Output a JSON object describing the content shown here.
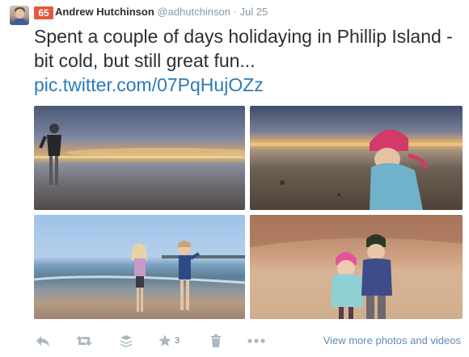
{
  "tweet": {
    "klout_score": "65",
    "author_name": "Andrew Hutchinson",
    "author_handle": "@adhutchinson",
    "separator": "·",
    "timestamp": "Jul 25",
    "text": "Spent a couple of days holidaying in Phillip Island - bit cold, but still great fun...",
    "link": "pic.twitter.com/07PqHujOZz"
  },
  "photos": [
    {
      "alt": "person standing on beach at sunset"
    },
    {
      "alt": "child in pink hat playing in sand"
    },
    {
      "alt": "two children on beach by the water"
    },
    {
      "alt": "two children in beanies on sand dunes"
    }
  ],
  "actions": {
    "favorite_count": "3",
    "view_more_label": "View more photos and videos"
  },
  "icons": [
    "reply-icon",
    "retweet-icon",
    "buffer-icon",
    "star-icon",
    "delete-icon",
    "more-icon"
  ],
  "colors": {
    "link": "#2b7bb9",
    "klout_badge": "#e2583e",
    "muted": "#8899a6",
    "action_icon": "#aab8c2"
  }
}
